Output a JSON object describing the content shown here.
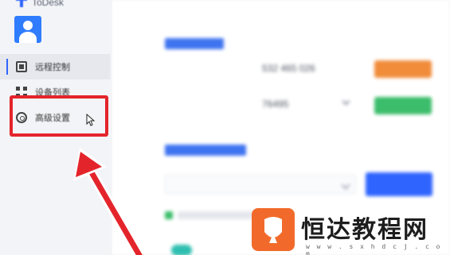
{
  "app": {
    "title": "ToDesk"
  },
  "profile": {
    "name": ""
  },
  "sidebar": {
    "items": [
      {
        "label": "远程控制",
        "icon": "remote-control-icon",
        "active": true
      },
      {
        "label": "设备列表",
        "icon": "device-grid-icon",
        "active": false
      },
      {
        "label": "高级设置",
        "icon": "gear-icon",
        "active": false
      }
    ]
  },
  "main": {
    "section1": {
      "title": ""
    },
    "device_code_label": "",
    "device_code": "532 465 026",
    "row1_button": "",
    "password_label": "",
    "password": "76495",
    "row2_button": "",
    "section2": {
      "title": ""
    },
    "remote_input_placeholder": "",
    "connect_button": ""
  },
  "watermark": {
    "text": "恒达教程网",
    "url": "w w w . s x h d c j . c o m"
  },
  "colors": {
    "accent": "#2f64ff",
    "highlight": "#e4242b",
    "orange": "#f08c3a",
    "green": "#3cbd6b"
  }
}
